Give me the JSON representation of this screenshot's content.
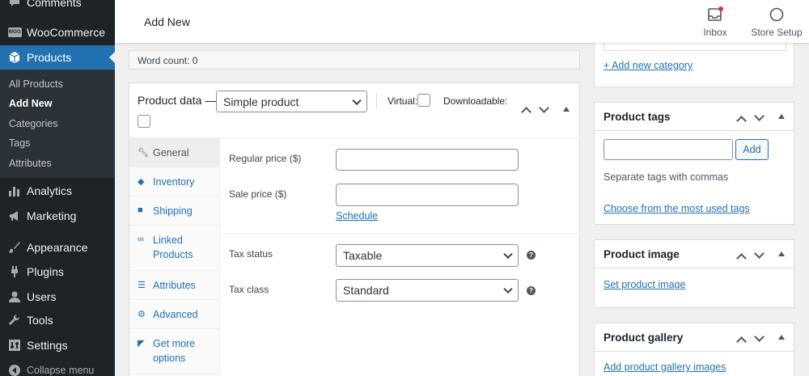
{
  "sidebar": {
    "comments": "Comments",
    "woocommerce": "WooCommerce",
    "woo_badge": "WOO",
    "products": "Products",
    "submenu": [
      "All Products",
      "Add New",
      "Categories",
      "Tags",
      "Attributes"
    ],
    "analytics": "Analytics",
    "marketing": "Marketing",
    "appearance": "Appearance",
    "plugins": "Plugins",
    "users": "Users",
    "tools": "Tools",
    "settings": "Settings",
    "collapse": "Collapse menu"
  },
  "header": {
    "title": "Add New",
    "inbox": "Inbox",
    "store_setup": "Store Setup"
  },
  "editor": {
    "word_count": "Word count: 0"
  },
  "product_data": {
    "title": "Product data —",
    "type_selected": "Simple product",
    "virtual_label": "Virtual:",
    "downloadable_label": "Downloadable:",
    "tabs": [
      "General",
      "Inventory",
      "Shipping",
      "Linked Products",
      "Attributes",
      "Advanced",
      "Get more options"
    ],
    "regular_price_label": "Regular price ($)",
    "sale_price_label": "Sale price ($)",
    "schedule_link": "Schedule",
    "tax_status_label": "Tax status",
    "tax_status_value": "Taxable",
    "tax_class_label": "Tax class",
    "tax_class_value": "Standard"
  },
  "categories_box": {
    "add_new_category": "+ Add new category"
  },
  "tags_box": {
    "title": "Product tags",
    "add_button": "Add",
    "hint": "Separate tags with commas",
    "choose_link": "Choose from the most used tags"
  },
  "image_box": {
    "title": "Product image",
    "set_link": "Set product image"
  },
  "gallery_box": {
    "title": "Product gallery",
    "add_link": "Add product gallery images"
  }
}
